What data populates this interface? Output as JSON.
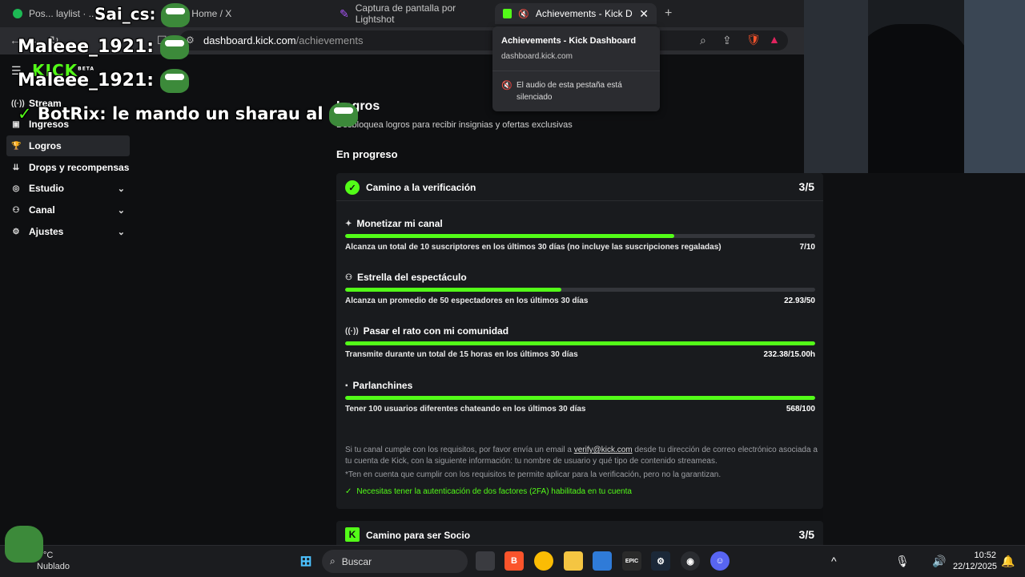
{
  "tabs": [
    {
      "label": "Pos... laylist · ...",
      "color": "#1db954"
    },
    {
      "label": "Home / X",
      "color": "#ffffff"
    },
    {
      "label": "Captura de pantalla por Lightshot",
      "color": "#a855f7"
    },
    {
      "label": "Achievements - Kick Dashboa",
      "color": "#53fc18"
    }
  ],
  "url": {
    "host": "dashboard.kick.com",
    "path": "/achievements"
  },
  "popup": {
    "title": "Achievements - Kick Dashboard",
    "url": "dashboard.kick.com",
    "message": "El audio de esta pestaña está silenciado"
  },
  "sidebar": {
    "logo": "KICK",
    "logo_badge": "BETA",
    "items": [
      {
        "label": "Stream",
        "icon": "broadcast-icon"
      },
      {
        "label": "Ingresos",
        "icon": "money-icon"
      },
      {
        "label": "Logros",
        "icon": "trophy-icon",
        "active": true
      },
      {
        "label": "Drops y recompensas",
        "icon": "gift-icon"
      },
      {
        "label": "Estudio",
        "icon": "studio-icon",
        "expandable": true
      },
      {
        "label": "Canal",
        "icon": "channel-icon",
        "expandable": true
      },
      {
        "label": "Ajustes",
        "icon": "gear-icon",
        "expandable": true
      }
    ]
  },
  "main": {
    "title": "Logros",
    "subtitle": "Desbloquea logros para recibir insignias y ofertas exclusivas",
    "section": "En progreso",
    "card1": {
      "title": "Camino a la verificación",
      "score": "3/5",
      "requirements": [
        {
          "title": "Monetizar mi canal",
          "desc": "Alcanza un total de 10 suscriptores en los últimos 30 días (no incluye las suscripciones regaladas)",
          "value": "7/10",
          "progress": 0.7
        },
        {
          "title": "Estrella del espectáculo",
          "desc": "Alcanza un promedio de 50 espectadores en los últimos 30 días",
          "value": "22.93/50",
          "progress": 0.46
        },
        {
          "title": "Pasar el rato con mi comunidad",
          "desc": "Transmite durante un total de 15 horas en los últimos 30 días",
          "value": "232.38/15.00h",
          "progress": 1.0
        },
        {
          "title": "Parlanchines",
          "desc": "Tener 100 usuarios diferentes chateando en los últimos 30 días",
          "value": "568/100",
          "progress": 1.0
        }
      ],
      "note_before": "Si tu canal cumple con los requisitos, por favor envía un email a ",
      "note_link": "verify@kick.com",
      "note_after": " desde tu dirección de correo electrónico asociada a tu cuenta de Kick, con la siguiente información: tu nombre de usuario y qué tipo de contenido streameas.",
      "note2": "*Ten en cuenta que cumplir con los requisitos te permite aplicar para la verificación, pero no la garantizan.",
      "note3": "Necesitas tener la autenticación de dos factores (2FA) habilitada en tu cuenta"
    },
    "card2": {
      "title": "Camino para ser Socio",
      "score": "3/5"
    }
  },
  "overlay": {
    "top_name": "Sai_cs:",
    "chat": [
      {
        "user": "Maleee_1921:",
        "text": ""
      },
      {
        "user": "Maleee_1921:",
        "text": ""
      },
      {
        "user": "BotRix:",
        "text": "le mando un sharau al"
      }
    ]
  },
  "taskbar": {
    "search": "Buscar",
    "weather_temp": "°C",
    "weather_desc": "Nublado",
    "time": "10:52",
    "date": "22/12/2025"
  }
}
